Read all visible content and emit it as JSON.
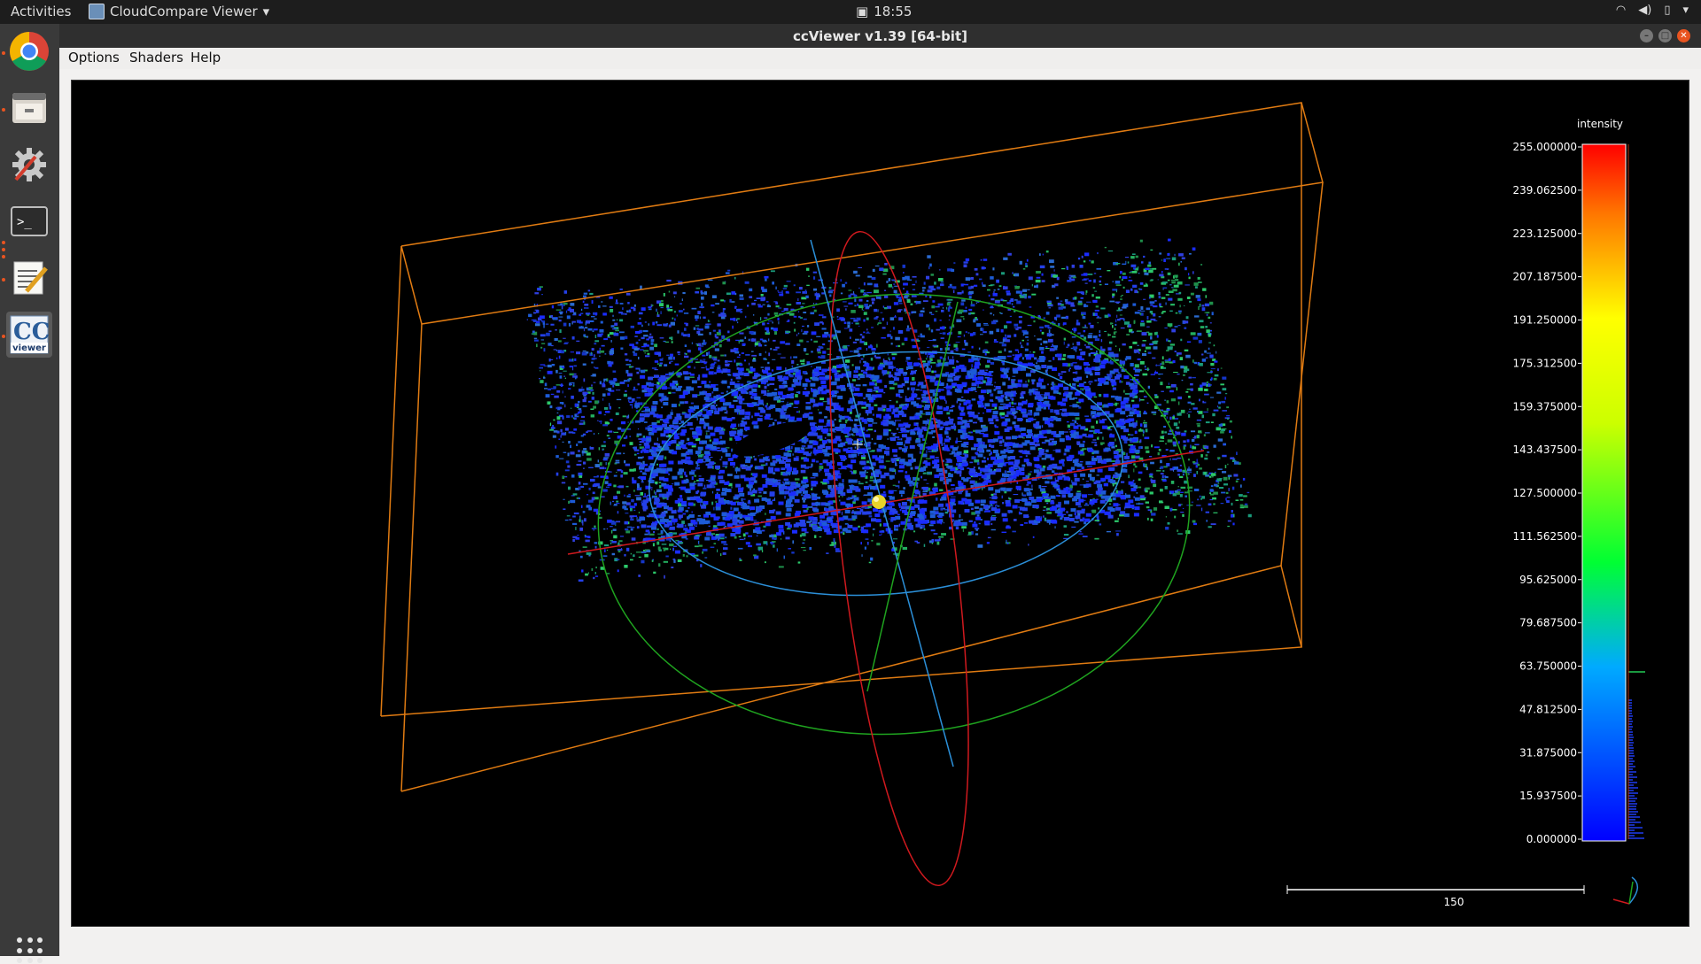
{
  "topbar": {
    "activities": "Activities",
    "app_name": "CloudCompare Viewer",
    "clock": "18:55"
  },
  "dock": {
    "items": [
      {
        "name": "chrome-icon"
      },
      {
        "name": "files-icon"
      },
      {
        "name": "settings-icon"
      },
      {
        "name": "terminal-icon"
      },
      {
        "name": "text-editor-icon"
      },
      {
        "name": "ccviewer-icon",
        "label": "viewer"
      }
    ]
  },
  "window": {
    "title": "ccViewer v1.39 [64-bit]"
  },
  "menu": {
    "options": "Options",
    "shaders": "Shaders",
    "help": "Help"
  },
  "scalar_bar": {
    "title": "intensity",
    "ticks": [
      "255.000000",
      "239.062500",
      "223.125000",
      "207.187500",
      "191.250000",
      "175.312500",
      "159.375000",
      "143.437500",
      "127.500000",
      "111.562500",
      "95.625000",
      "79.687500",
      "63.750000",
      "47.812500",
      "31.875000",
      "15.937500",
      "0.000000"
    ]
  },
  "scale": {
    "label": "150"
  },
  "colors": {
    "bbox": "#e07b12",
    "sphere_red": "#d0191e",
    "sphere_green": "#1fa31f",
    "sphere_blue": "#2b8fd8"
  }
}
